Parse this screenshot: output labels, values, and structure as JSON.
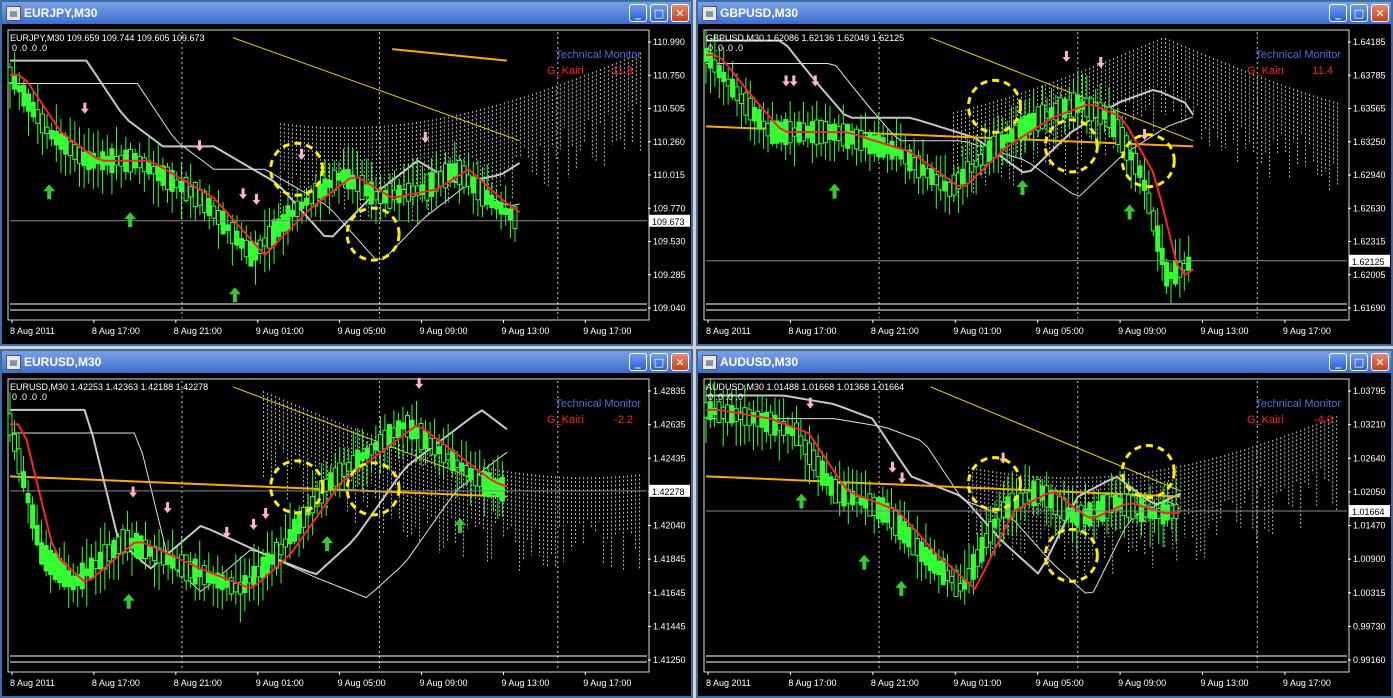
{
  "colors": {
    "candle": "#33ff33",
    "red_ma": "#ff2222",
    "orange_ma": "#ffaa00",
    "yellow_ma": "#e8d800",
    "gray_ma": "#c8c8c8",
    "white_ma": "#e0e0e0",
    "marker": "#ffee00",
    "pink_arrow": "#ffb6c1",
    "green_arrow": "#33cc33",
    "dark_green_arrow": "#2d8a3a",
    "price_line": "#888888",
    "monitor_text": "#4a6fd8",
    "kairi_text": "#ff2222",
    "axis_text": "#ffffff"
  },
  "icons": {
    "window_icon": "chart-window-icon",
    "minimize": "minimize-icon",
    "maximize": "maximize-icon",
    "close": "close-icon"
  },
  "buttons": {
    "minimize": "_",
    "maximize": "□",
    "close": "✕"
  },
  "windows": [
    {
      "id": "eurjpy",
      "title": "EURJPY,M30",
      "header": "EURJPY,M30  109.659 109.744 109.605 109.673",
      "zeros": "0 .0 .0 .0",
      "monitor": "Technical  Monitor",
      "kairi_label": "G_Kairi",
      "kairi_value": "-11.8",
      "price_label": "109.673",
      "y_labels": [
        "110.990",
        "110.750",
        "110.505",
        "110.260",
        "110.015",
        "109.770",
        "109.530",
        "109.285",
        "109.040"
      ],
      "x_labels": [
        "8 Aug 2011",
        "8 Aug 17:00",
        "8 Aug 21:00",
        "9 Aug 01:00",
        "9 Aug 05:00",
        "9 Aug 09:00",
        "9 Aug 13:00",
        "9 Aug 17:00"
      ]
    },
    {
      "id": "gbpusd",
      "title": "GBPUSD,M30",
      "header": "GBPUSD,M30  1.62086 1.62136 1.62049 1.62125",
      "zeros": "0 .0 .0 .0",
      "monitor": "Technical  Monitor",
      "kairi_label": "G_Kairi",
      "kairi_value": "11.4",
      "price_label": "1.62125",
      "y_labels": [
        "1.64185",
        "1.63785",
        "1.63565",
        "1.63250",
        "1.62940",
        "1.62630",
        "1.62315",
        "1.62005",
        "1.61690"
      ],
      "x_labels": [
        "8 Aug 2011",
        "8 Aug 17:00",
        "8 Aug 21:00",
        "9 Aug 01:00",
        "9 Aug 05:00",
        "9 Aug 09:00",
        "9 Aug 13:00",
        "9 Aug 17:00"
      ]
    },
    {
      "id": "eurusd",
      "title": "EURUSD,M30",
      "header": "EURUSD,M30  1.42253 1.42363 1.42188 1.42278",
      "zeros": "0 .0 .0 .0",
      "monitor": "Technical  Monitor",
      "kairi_label": "G_Kairi",
      "kairi_value": "-2.2",
      "price_label": "1.42278",
      "y_labels": [
        "1.42835",
        "1.42635",
        "1.42435",
        "1.42240",
        "1.42040",
        "1.41845",
        "1.41645",
        "1.41445",
        "1.41250"
      ],
      "x_labels": [
        "8 Aug 2011",
        "8 Aug 17:00",
        "8 Aug 21:00",
        "9 Aug 01:00",
        "9 Aug 05:00",
        "9 Aug 09:00",
        "9 Aug 13:00",
        "9 Aug 17:00"
      ]
    },
    {
      "id": "audusd",
      "title": "AUDUSD,M30",
      "header": "AUDUSD,M30  1.01488 1.01668 1.01368 1.01664",
      "zeros": "0 .0 .0 .0",
      "monitor": "Technical  Monitor",
      "kairi_label": "G_Kairi",
      "kairi_value": "-4.0",
      "price_label": "1.01664",
      "y_labels": [
        "1.03795",
        "1.03210",
        "1.02640",
        "1.02050",
        "1.01470",
        "1.00900",
        "1.00315",
        "0.99730",
        "0.99160"
      ],
      "x_labels": [
        "8 Aug 2011",
        "8 Aug 17:00",
        "8 Aug 21:00",
        "9 Aug 01:00",
        "9 Aug 05:00",
        "9 Aug 09:00",
        "9 Aug 13:00",
        "9 Aug 17:00"
      ]
    }
  ]
}
